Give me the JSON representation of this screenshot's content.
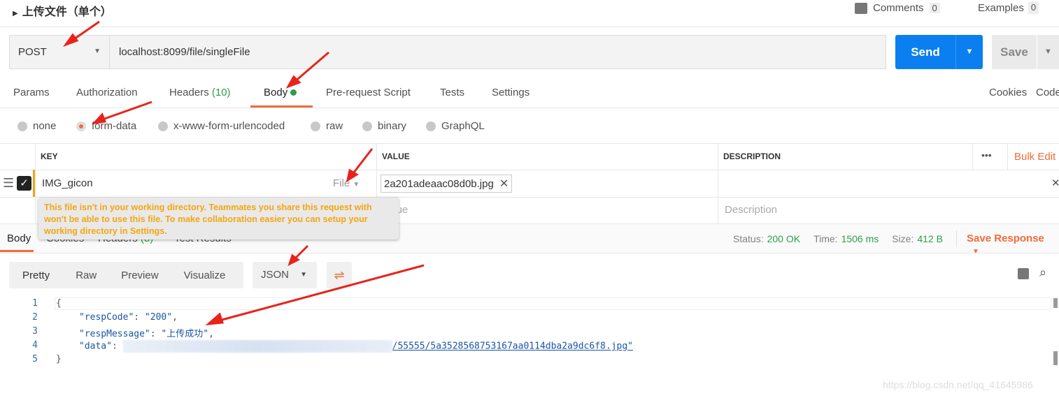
{
  "header": {
    "title": "上传文件（单个）",
    "comments_label": "Comments",
    "comments_count": "0",
    "examples_label": "Examples",
    "examples_count": "0"
  },
  "request": {
    "method": "POST",
    "url": "localhost:8099/file/singleFile",
    "send_label": "Send",
    "save_label": "Save"
  },
  "request_tabs": [
    {
      "label": "Params"
    },
    {
      "label": "Authorization"
    },
    {
      "label": "Headers",
      "count": "(10)"
    },
    {
      "label": "Body",
      "active": true
    },
    {
      "label": "Pre-request Script"
    },
    {
      "label": "Tests"
    },
    {
      "label": "Settings"
    }
  ],
  "request_links": {
    "cookies": "Cookies",
    "code": "Code"
  },
  "body_types": [
    {
      "label": "none"
    },
    {
      "label": "form-data",
      "selected": true
    },
    {
      "label": "x-www-form-urlencoded"
    },
    {
      "label": "raw"
    },
    {
      "label": "binary"
    },
    {
      "label": "GraphQL"
    }
  ],
  "table": {
    "headers": [
      "KEY",
      "VALUE",
      "DESCRIPTION"
    ],
    "bulk_edit": "Bulk Edit",
    "more": "•••",
    "rows": [
      {
        "checked": true,
        "key": "IMG_gicon",
        "type": "File",
        "value": "2a201adeaac08d0b.jpg",
        "description": ""
      }
    ],
    "placeholders": {
      "value": "Value",
      "description": "Description"
    }
  },
  "tooltip": "This file isn't in your working directory. Teammates you share this request with won't be able to use this file. To make collaboration easier you can setup your working directory in Settings.",
  "response_tabs": [
    {
      "label": "Body"
    },
    {
      "label": "Cookies"
    },
    {
      "label": "Headers",
      "count": "(8)"
    },
    {
      "label": "Test Results"
    }
  ],
  "status": {
    "status_label": "Status:",
    "status": "200 OK",
    "time_label": "Time:",
    "time": "1506 ms",
    "size_label": "Size:",
    "size": "412 B",
    "save_response": "Save Response"
  },
  "view_modes": [
    "Pretty",
    "Raw",
    "Preview",
    "Visualize"
  ],
  "format": "JSON",
  "code": {
    "line_numbers": [
      "1",
      "2",
      "3",
      "4",
      "5"
    ],
    "l1": "{",
    "l2_key": "\"respCode\"",
    "l2_val": "\"200\"",
    "l3_key": "\"respMessage\"",
    "l3_val": "\"上传成功\"",
    "l4_key": "\"data\"",
    "l4_val": "/55555/5a3528568753167aa0114dba2a9dc6f8.jpg\"",
    "l5": "}"
  },
  "watermark": "https://blog.csdn.net/qq_41645986",
  "colors": {
    "accent": "#f26b3a",
    "send": "#0b7ff0",
    "success": "#2c9e4b",
    "tooltip_text": "#f4a611"
  }
}
